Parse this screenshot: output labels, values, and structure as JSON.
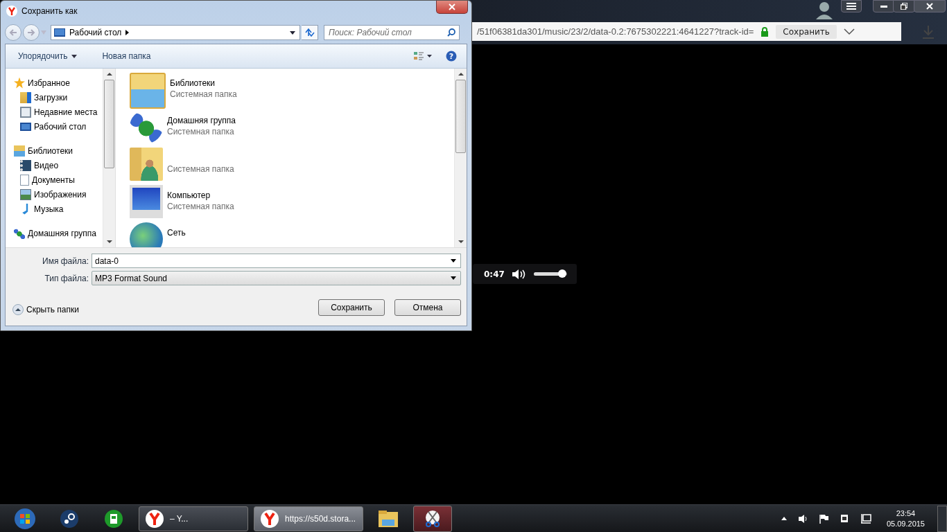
{
  "browser": {
    "address": "/51f06381da301/music/23/2/data-0.2:7675302221:4641227?track-id=",
    "save_button": "Сохранить"
  },
  "player": {
    "time": "0:47",
    "level": 0.85
  },
  "dialog": {
    "title": "Сохранить как",
    "location": "Рабочий стол",
    "search": {
      "placeholder": "Поиск: Рабочий стол"
    },
    "organize": "Упорядочить",
    "new_folder": "Новая папка",
    "nav": [
      {
        "label": "Избранное",
        "children": [
          {
            "label": "Загрузки"
          },
          {
            "label": "Недавние места"
          },
          {
            "label": "Рабочий стол"
          }
        ]
      },
      {
        "label": "Библиотеки",
        "children": [
          {
            "label": "Видео"
          },
          {
            "label": "Документы"
          },
          {
            "label": "Изображения"
          },
          {
            "label": "Музыка"
          }
        ]
      },
      {
        "label": "Домашняя группа"
      }
    ],
    "help": "?",
    "items": [
      {
        "name": "Библиотеки",
        "type": "Системная папка"
      },
      {
        "name": "Домашняя группа",
        "type": "Системная папка"
      },
      {
        "type": "Системная папка"
      },
      {
        "name": "Компьютер",
        "type": "Системная папка"
      },
      {
        "name": "Сеть"
      }
    ],
    "filename_label": "Имя файла:",
    "filename": "data-0",
    "filetype_label": "Тип файла:",
    "filetype": "MP3 Format Sound",
    "hide_folders": "Скрыть папки",
    "buttons": [
      "Сохранить",
      "Отмена"
    ]
  },
  "taskbar": {
    "windows": [
      {
        "label": "– Y...",
        "selected": false
      },
      {
        "label": "https://s50d.stora...",
        "selected": true
      }
    ],
    "time": "23:54",
    "date": "05.09.2015"
  }
}
